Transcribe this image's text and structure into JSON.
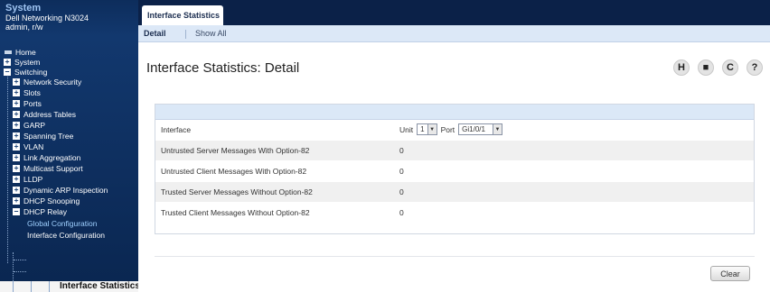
{
  "sidebar": {
    "system_title": "System",
    "model": "Dell Networking N3024",
    "user": "admin, r/w",
    "items": [
      {
        "label": "Home",
        "expander": ""
      },
      {
        "label": "System",
        "expander": "+"
      },
      {
        "label": "Switching",
        "expander": "−"
      },
      {
        "label": "Network Security",
        "expander": "+"
      },
      {
        "label": "Slots",
        "expander": "+"
      },
      {
        "label": "Ports",
        "expander": "+"
      },
      {
        "label": "Address Tables",
        "expander": "+"
      },
      {
        "label": "GARP",
        "expander": "+"
      },
      {
        "label": "Spanning Tree",
        "expander": "+"
      },
      {
        "label": "VLAN",
        "expander": "+"
      },
      {
        "label": "Link Aggregation",
        "expander": "+"
      },
      {
        "label": "Multicast Support",
        "expander": "+"
      },
      {
        "label": "LLDP",
        "expander": "+"
      },
      {
        "label": "Dynamic ARP Inspection",
        "expander": "+"
      },
      {
        "label": "DHCP Snooping",
        "expander": "+"
      },
      {
        "label": "DHCP Relay",
        "expander": "−"
      },
      {
        "label": "Global Configuration",
        "expander": ""
      },
      {
        "label": "Interface Configuration",
        "expander": ""
      },
      {
        "label": "Interface Statistics",
        "expander": ""
      }
    ]
  },
  "tabs": {
    "active": "Interface Statistics"
  },
  "subnav": {
    "detail": "Detail",
    "show_all": "Show All"
  },
  "page": {
    "title": "Interface Statistics: Detail"
  },
  "toolbar": {
    "help_label": "H",
    "print_label": "■",
    "refresh_label": "C",
    "question_label": "?"
  },
  "table": {
    "interface_label": "Interface",
    "unit_label": "Unit",
    "unit_value": "1",
    "port_label": "Port",
    "port_value": "Gi1/0/1",
    "rows": [
      {
        "label": "Untrusted Server Messages With Option-82",
        "value": "0"
      },
      {
        "label": "Untrusted Client Messages With Option-82",
        "value": "0"
      },
      {
        "label": "Trusted Server Messages Without Option-82",
        "value": "0"
      },
      {
        "label": "Trusted Client Messages Without Option-82",
        "value": "0"
      }
    ]
  },
  "buttons": {
    "clear": "Clear"
  },
  "colors": {
    "sidebar_bg": "#12386e",
    "tabbar_bg": "#0b2148",
    "subnav_bg": "#dce8f7",
    "selected_link": "#9fd0ff"
  }
}
